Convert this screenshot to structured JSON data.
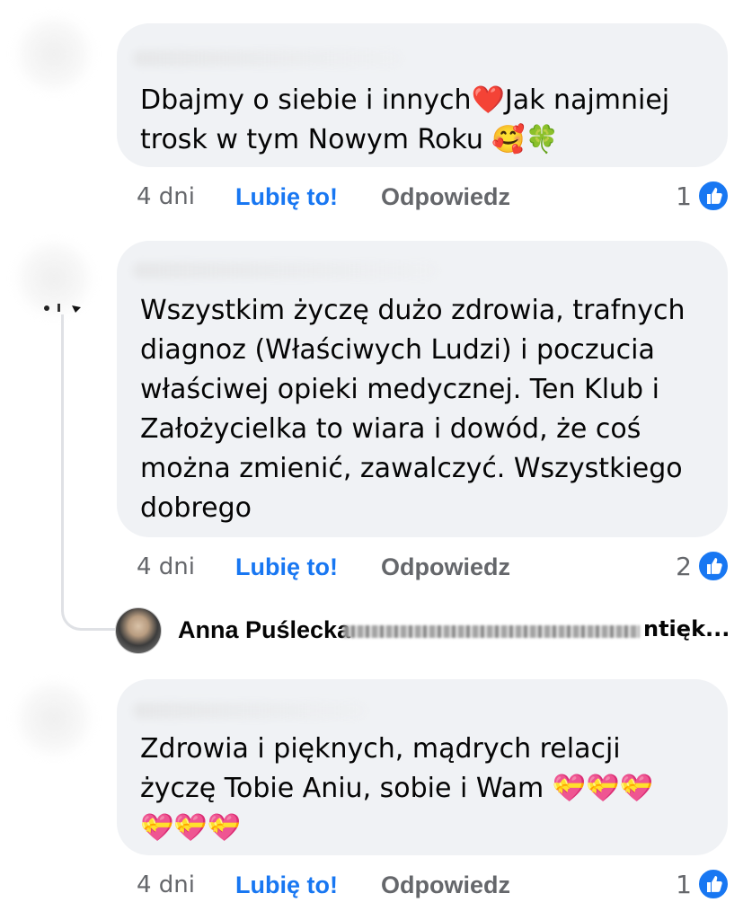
{
  "comments": [
    {
      "text": "Dbajmy o siebie i innych❤️Jak najmniej\ntrosk w tym Nowym Roku 🥰🍀",
      "time": "4 dni",
      "like_label": "Lubię to!",
      "reply_label": "Odpowiedz",
      "reaction_count": "1"
    },
    {
      "text": "Wszystkim życzę dużo zdrowia, trafnych\ndiagnoz (Właściwych Ludzi) i poczucia\nwłaściwej opieki medycznej. Ten Klub i\nZałożycielka to wiara i dowód, że coś\nmożna zmienić, zawalczyć. Wszystkiego\ndobrego",
      "time": "4 dni",
      "like_label": "Lubię to!",
      "reply_label": "Odpowiedz",
      "reaction_count": "2"
    },
    {
      "text": "Zdrowia i pięknych, mądrych relacji\nżyczę Tobie Aniu, sobie i Wam 💝💝💝\n💝💝💝",
      "time": "4 dni",
      "like_label": "Lubię to!",
      "reply_label": "Odpowiedz",
      "reaction_count": "1"
    }
  ],
  "reply_preview": {
    "author": "Anna Puślecka",
    "snippet": "ntięk..."
  },
  "icons": {
    "reaction": "like-thumb-icon"
  },
  "colors": {
    "accent": "#1877f2",
    "bubble": "#f0f2f5",
    "muted": "#65676b"
  }
}
